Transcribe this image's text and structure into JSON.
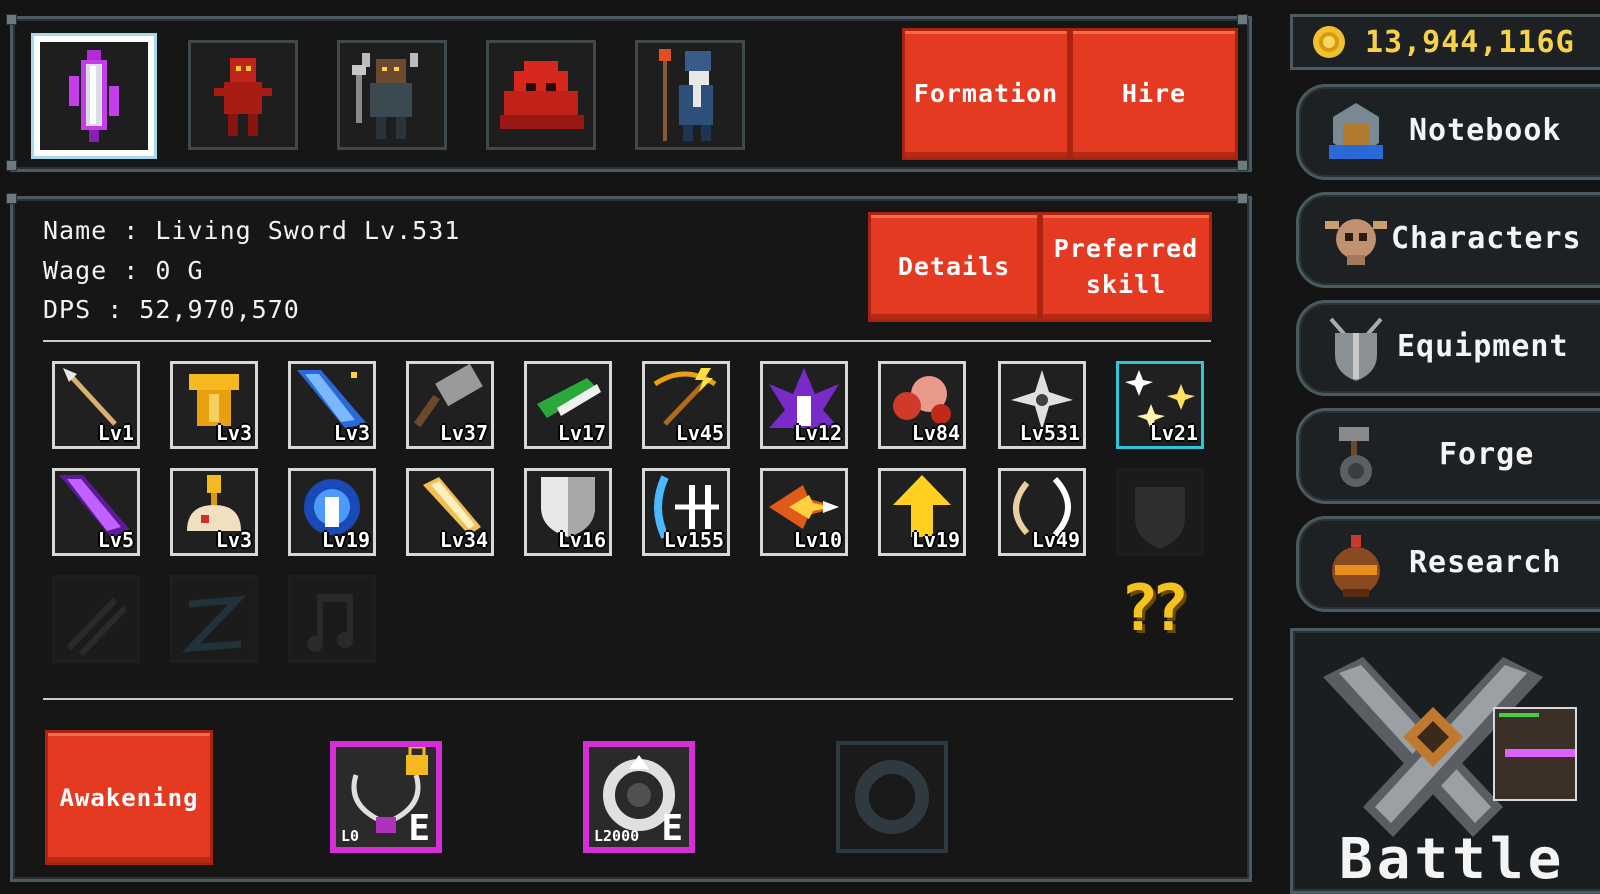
{
  "party": {
    "members": [
      {
        "name": "living-sword",
        "selected": true
      },
      {
        "name": "red-imp"
      },
      {
        "name": "horned-warrior"
      },
      {
        "name": "red-slime"
      },
      {
        "name": "staff-wizard"
      }
    ],
    "formation_label": "Formation",
    "hire_label": "Hire"
  },
  "character": {
    "name_line": "Name : Living Sword Lv.531",
    "wage_line": "Wage : 0 G",
    "dps_line": "DPS : 52,970,570",
    "details_label": "Details",
    "preferred_skill_label": "Preferred skill"
  },
  "skills": {
    "row1": [
      {
        "icon": "spear-icon",
        "level": "Lv1"
      },
      {
        "icon": "golden-armor-icon",
        "level": "Lv3"
      },
      {
        "icon": "blue-meteor-icon",
        "level": "Lv3"
      },
      {
        "icon": "hammer-icon",
        "level": "Lv37"
      },
      {
        "icon": "green-slash-icon",
        "level": "Lv17"
      },
      {
        "icon": "lightning-crossbow-icon",
        "level": "Lv45"
      },
      {
        "icon": "purple-aura-icon",
        "level": "Lv12"
      },
      {
        "icon": "flesh-icon",
        "level": "Lv84"
      },
      {
        "icon": "shuriken-icon",
        "level": "Lv531"
      },
      {
        "icon": "stars-icon",
        "level": "Lv21"
      }
    ],
    "row2": [
      {
        "icon": "purple-comet-icon",
        "level": "Lv5"
      },
      {
        "icon": "golden-chalice-icon",
        "level": "Lv3"
      },
      {
        "icon": "blue-spirit-icon",
        "level": "Lv19"
      },
      {
        "icon": "golden-blade-icon",
        "level": "Lv34"
      },
      {
        "icon": "silver-shield-icon",
        "level": "Lv16"
      },
      {
        "icon": "ice-bow-icon",
        "level": "Lv155"
      },
      {
        "icon": "fire-burst-icon",
        "level": "Lv10"
      },
      {
        "icon": "up-arrow-icon",
        "level": "Lv19"
      },
      {
        "icon": "crescent-icon",
        "level": "Lv49"
      }
    ],
    "locked": [
      "locked-shield-icon",
      "locked-claw-icon",
      "locked-z-icon",
      "locked-note-icon"
    ],
    "mystery_text": "??"
  },
  "gold": {
    "amount": "13,944,116G"
  },
  "menu": [
    {
      "label": "Notebook",
      "icon": "notebook-icon"
    },
    {
      "label": "Characters",
      "icon": "skull-icon"
    },
    {
      "label": "Equipment",
      "icon": "armor-icon"
    },
    {
      "label": "Forge",
      "icon": "anvil-icon"
    },
    {
      "label": "Research",
      "icon": "cauldron-icon"
    }
  ],
  "battle": {
    "label": "Battle"
  },
  "awakening": {
    "label": "Awakening"
  },
  "equipment_slots": [
    {
      "level": "L0",
      "rank": "E",
      "locked": true,
      "icon": "necklace-icon"
    },
    {
      "level": "L2000",
      "rank": "E",
      "locked": false,
      "icon": "silver-ring-icon"
    },
    {
      "empty": true
    }
  ],
  "colors": {
    "accent_red": "#e53a22",
    "gold": "#f0c030",
    "rare_frame": "#d42fd6",
    "highlight_frame": "#2fc6d8"
  }
}
